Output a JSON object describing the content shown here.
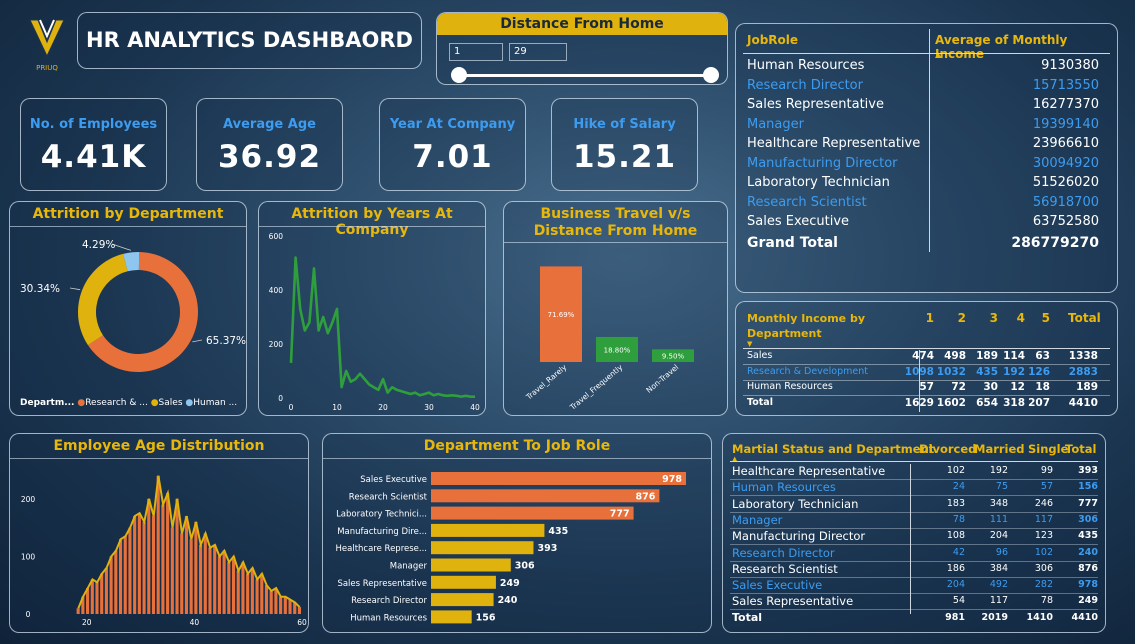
{
  "logo": {
    "text": "PRIUQ"
  },
  "title": "HR ANALYTICS DASHBAORD",
  "slicer": {
    "title": "Distance From Home",
    "min": "1",
    "max": "29"
  },
  "kpis": [
    {
      "label": "No. of Employees",
      "value": "4.41K"
    },
    {
      "label": "Average Age",
      "value": "36.92"
    },
    {
      "label": "Year At Company",
      "value": "7.01"
    },
    {
      "label": "Hike of Salary",
      "value": "15.21"
    }
  ],
  "jobrole_table": {
    "headers": [
      "JobRole",
      "Average of Monthly Income"
    ],
    "rows": [
      {
        "role": "Human Resources",
        "value": "9130380"
      },
      {
        "role": "Research Director",
        "value": "15713550"
      },
      {
        "role": "Sales Representative",
        "value": "16277370"
      },
      {
        "role": "Manager",
        "value": "19399140"
      },
      {
        "role": "Healthcare Representative",
        "value": "23966610"
      },
      {
        "role": "Manufacturing Director",
        "value": "30094920"
      },
      {
        "role": "Laboratory Technician",
        "value": "51526020"
      },
      {
        "role": "Research Scientist",
        "value": "56918700"
      },
      {
        "role": "Sales Executive",
        "value": "63752580"
      }
    ],
    "total_label": "Grand Total",
    "total_value": "286779270"
  },
  "income_table": {
    "title": "Monthly Income by Department",
    "headers": [
      "1",
      "2",
      "3",
      "4",
      "5",
      "Total"
    ],
    "rows": [
      {
        "dept": "Sales",
        "vals": [
          "474",
          "498",
          "189",
          "114",
          "63",
          "1338"
        ]
      },
      {
        "dept": "Research & Development",
        "vals": [
          "1098",
          "1032",
          "435",
          "192",
          "126",
          "2883"
        ]
      },
      {
        "dept": "Human Resources",
        "vals": [
          "57",
          "72",
          "30",
          "12",
          "18",
          "189"
        ]
      }
    ],
    "total": {
      "dept": "Total",
      "vals": [
        "1629",
        "1602",
        "654",
        "318",
        "207",
        "4410"
      ]
    }
  },
  "marital_table": {
    "headers": [
      "Martial Status and Department",
      "Divorced",
      "Married",
      "Single",
      "Total"
    ],
    "rows": [
      {
        "role": "Healthcare Representative",
        "vals": [
          "102",
          "192",
          "99",
          "393"
        ]
      },
      {
        "role": "Human Resources",
        "vals": [
          "24",
          "75",
          "57",
          "156"
        ]
      },
      {
        "role": "Laboratory Technician",
        "vals": [
          "183",
          "348",
          "246",
          "777"
        ]
      },
      {
        "role": "Manager",
        "vals": [
          "78",
          "111",
          "117",
          "306"
        ]
      },
      {
        "role": "Manufacturing Director",
        "vals": [
          "108",
          "204",
          "123",
          "435"
        ]
      },
      {
        "role": "Research Director",
        "vals": [
          "42",
          "96",
          "102",
          "240"
        ]
      },
      {
        "role": "Research Scientist",
        "vals": [
          "186",
          "384",
          "306",
          "876"
        ]
      },
      {
        "role": "Sales Executive",
        "vals": [
          "204",
          "492",
          "282",
          "978"
        ]
      },
      {
        "role": "Sales Representative",
        "vals": [
          "54",
          "117",
          "78",
          "249"
        ]
      }
    ],
    "total": {
      "role": "Total",
      "vals": [
        "981",
        "2019",
        "1410",
        "4410"
      ]
    }
  },
  "colors": {
    "orange": "#e8703a",
    "yellow": "#e0b20e",
    "lightblue": "#8ec6ef",
    "green": "#2f9e3c",
    "blue": "#3d9cf0"
  },
  "chart_data": [
    {
      "type": "pie",
      "title": "Attrition by Department",
      "legend_title": "Departm...",
      "legend": [
        "Research & ...",
        "Sales",
        "Human ..."
      ],
      "labels": [
        "65.37%",
        "30.34%",
        "4.29%"
      ],
      "values": [
        65.37,
        30.34,
        4.29
      ],
      "colors": [
        "#e8703a",
        "#e0b20e",
        "#8ec6ef"
      ]
    },
    {
      "type": "line",
      "title": "Attrition by Years At Company",
      "x": [
        0,
        1,
        2,
        3,
        4,
        5,
        6,
        7,
        8,
        9,
        10,
        11,
        12,
        13,
        14,
        15,
        16,
        17,
        18,
        19,
        20,
        21,
        22,
        23,
        24,
        25,
        26,
        27,
        28,
        29,
        30,
        31,
        32,
        33,
        34,
        35,
        36,
        37,
        38,
        39,
        40
      ],
      "y": [
        130,
        520,
        330,
        250,
        280,
        480,
        250,
        300,
        240,
        280,
        330,
        40,
        100,
        60,
        70,
        90,
        70,
        50,
        40,
        30,
        70,
        20,
        40,
        30,
        25,
        20,
        15,
        20,
        10,
        15,
        20,
        10,
        15,
        10,
        8,
        10,
        8,
        5,
        8,
        5,
        5
      ],
      "xticks": [
        "0",
        "10",
        "20",
        "30",
        "40"
      ],
      "yticks": [
        "0",
        "200",
        "400",
        "600"
      ],
      "xlim": [
        0,
        40
      ],
      "ylim": [
        0,
        600
      ]
    },
    {
      "type": "bar",
      "title": "Business Travel v/s Distance From Home",
      "categories": [
        "Travel_Rarely",
        "Travel_Frequently",
        "Non-Travel"
      ],
      "values": [
        71.69,
        18.8,
        9.5
      ],
      "labels": [
        "71.69%",
        "18.80%",
        "9.50%"
      ],
      "colors": [
        "#e8703a",
        "#2f9e3c",
        "#2f9e3c"
      ]
    },
    {
      "type": "bar",
      "title": "Employee Age Distribution",
      "x_start": 18,
      "values": [
        10,
        30,
        45,
        60,
        55,
        70,
        80,
        100,
        110,
        130,
        135,
        150,
        170,
        175,
        160,
        200,
        170,
        240,
        190,
        210,
        150,
        200,
        140,
        170,
        130,
        160,
        120,
        140,
        115,
        120,
        100,
        110,
        90,
        100,
        75,
        90,
        70,
        80,
        60,
        70,
        50,
        40,
        45,
        30,
        30,
        25,
        20,
        12
      ],
      "xticks": [
        "20",
        "40",
        "60"
      ],
      "yticks": [
        "0",
        "100",
        "200"
      ],
      "xlim": [
        18,
        60
      ],
      "ylim": [
        0,
        250
      ]
    },
    {
      "type": "bar",
      "title": "Department To Job Role",
      "categories": [
        "Sales Executive",
        "Research Scientist",
        "Laboratory Technici...",
        "Manufacturing Dire...",
        "Healthcare Represe...",
        "Manager",
        "Sales Representative",
        "Research Director",
        "Human Resources"
      ],
      "values": [
        978,
        876,
        777,
        435,
        393,
        306,
        249,
        240,
        156
      ],
      "colors": [
        "#e8703a",
        "#e8703a",
        "#e8703a",
        "#e0b20e",
        "#e0b20e",
        "#e0b20e",
        "#e0b20e",
        "#e0b20e",
        "#e0b20e"
      ]
    }
  ]
}
